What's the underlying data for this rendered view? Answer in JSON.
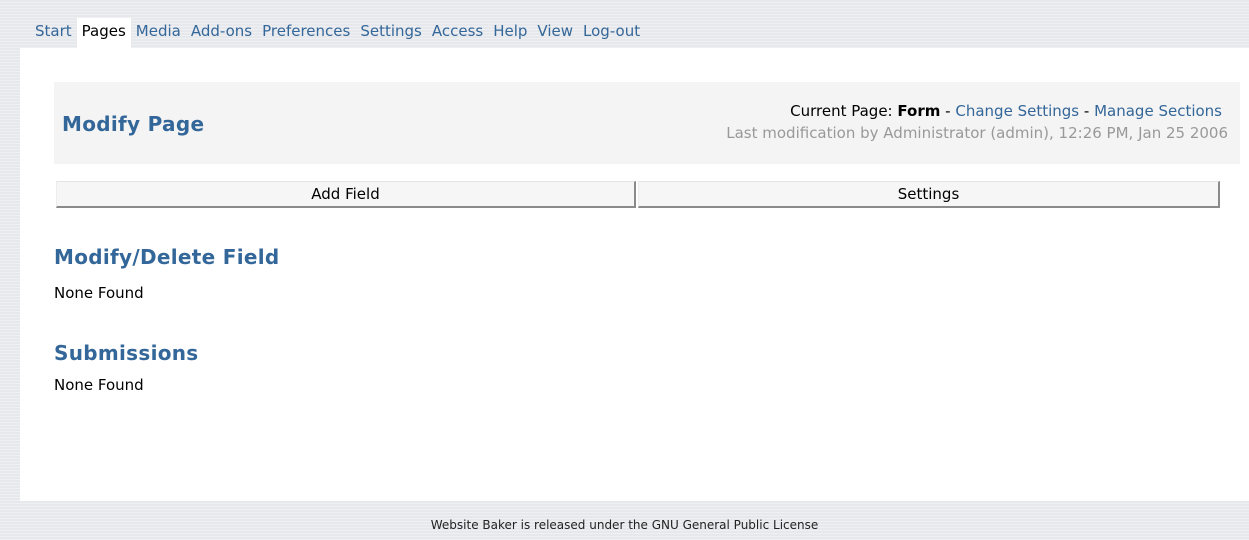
{
  "nav": {
    "items": [
      {
        "label": "Start"
      },
      {
        "label": "Pages"
      },
      {
        "label": "Media"
      },
      {
        "label": "Add-ons"
      },
      {
        "label": "Preferences"
      },
      {
        "label": "Settings"
      },
      {
        "label": "Access"
      },
      {
        "label": "Help"
      },
      {
        "label": "View"
      },
      {
        "label": "Log-out"
      }
    ],
    "active": "Pages"
  },
  "header": {
    "title": "Modify Page",
    "current_page_prefix": "Current Page:",
    "current_page_name": "Form",
    "separator": "-",
    "change_settings_link": "Change Settings",
    "manage_sections_link": "Manage Sections",
    "last_modification": "Last modification by Administrator (admin), 12:26 PM, Jan 25 2006"
  },
  "tabs": {
    "add_field": "Add Field",
    "settings": "Settings"
  },
  "sections": {
    "modify_delete": {
      "heading": "Modify/Delete Field",
      "empty_text": "None Found"
    },
    "submissions": {
      "heading": "Submissions",
      "empty_text": "None Found"
    }
  },
  "footer": {
    "text": "Website Baker is released under the GNU General Public License"
  },
  "colors": {
    "link": "#336699",
    "heading": "#336699",
    "muted": "#999999",
    "background": "#e6e8ec"
  }
}
